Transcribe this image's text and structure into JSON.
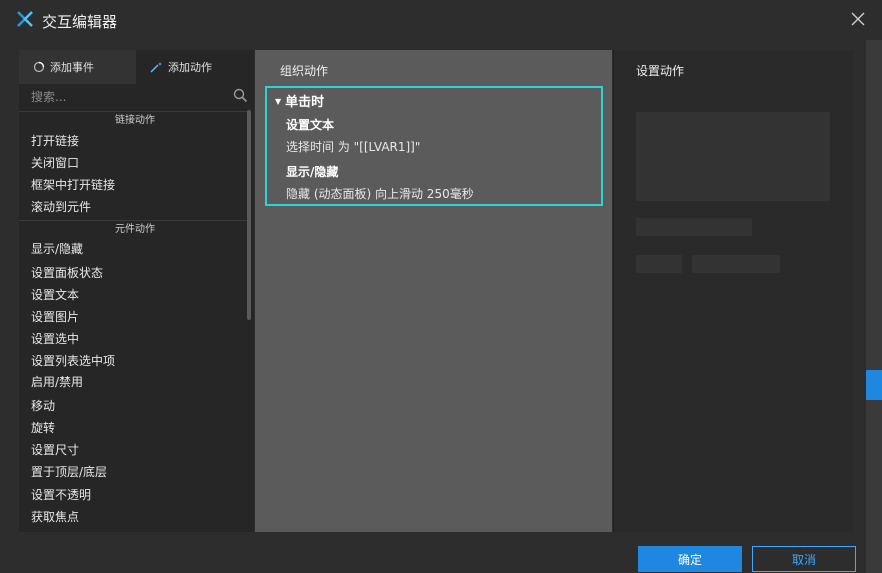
{
  "window": {
    "title": "交互编辑器"
  },
  "left_panel": {
    "tabs": [
      {
        "label": "添加事件"
      },
      {
        "label": "添加动作"
      }
    ],
    "search_placeholder": "搜索...",
    "categories": [
      {
        "name": "链接动作",
        "items": [
          "打开链接",
          "关闭窗口",
          "框架中打开链接",
          "滚动到元件"
        ]
      },
      {
        "name": "元件动作",
        "items": [
          "显示/隐藏",
          "设置面板状态",
          "设置文本",
          "设置图片",
          "设置选中",
          "设置列表选中项",
          "启用/禁用",
          "移动",
          "旋转",
          "设置尺寸",
          "置于顶层/底层",
          "设置不透明",
          "获取焦点"
        ]
      }
    ]
  },
  "middle_panel": {
    "title": "组织动作",
    "event": "单击时",
    "actions": [
      {
        "title": "设置文本",
        "desc": "选择时间 为 \"[[LVAR1]]\""
      },
      {
        "title": "显示/隐藏",
        "desc": "隐藏 (动态面板) 向上滑动 250毫秒"
      }
    ]
  },
  "right_panel": {
    "title": "设置动作"
  },
  "buttons": {
    "ok": "确定",
    "cancel": "取消"
  },
  "colors": {
    "accent_blue": "#1f87e0",
    "event_border": "#2bd4d4"
  }
}
